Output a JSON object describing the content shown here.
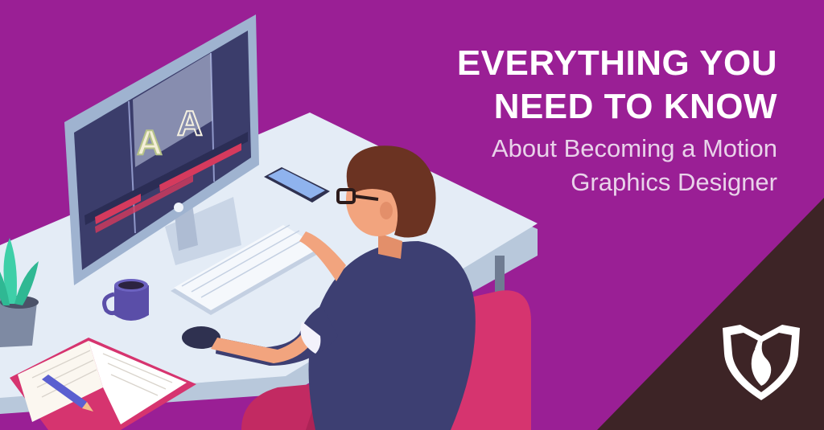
{
  "headline": {
    "line1": "EVERYTHING YOU",
    "line2": "NEED TO KNOW",
    "sub1": "About Becoming a Motion",
    "sub2": "Graphics Designer"
  },
  "screen_glyphs": [
    "A",
    "A"
  ],
  "colors": {
    "background": "#9a1f95",
    "corner_band": "#3d2426",
    "desk_top": "#e4ecf6",
    "desk_edge": "#b8c8db",
    "monitor_frame": "#9fb3d0",
    "monitor_screen": "#3b3d6b",
    "timeline_red": "#d53a5d",
    "hair": "#6b3322",
    "shirt": "#3d3f72",
    "skin": "#f2a47e",
    "chair": "#d6346f",
    "mug": "#5a4ea8",
    "plant": "#3ecfa8",
    "book_cover": "#d6346f",
    "pencil": "#5a5fd0",
    "shield_logo": "#ffffff"
  },
  "icons": [
    "college-shield-logo",
    "monitor",
    "phone",
    "keyboard",
    "coffee-mug",
    "plant",
    "open-notebook",
    "pencil",
    "mouse",
    "glasses"
  ]
}
